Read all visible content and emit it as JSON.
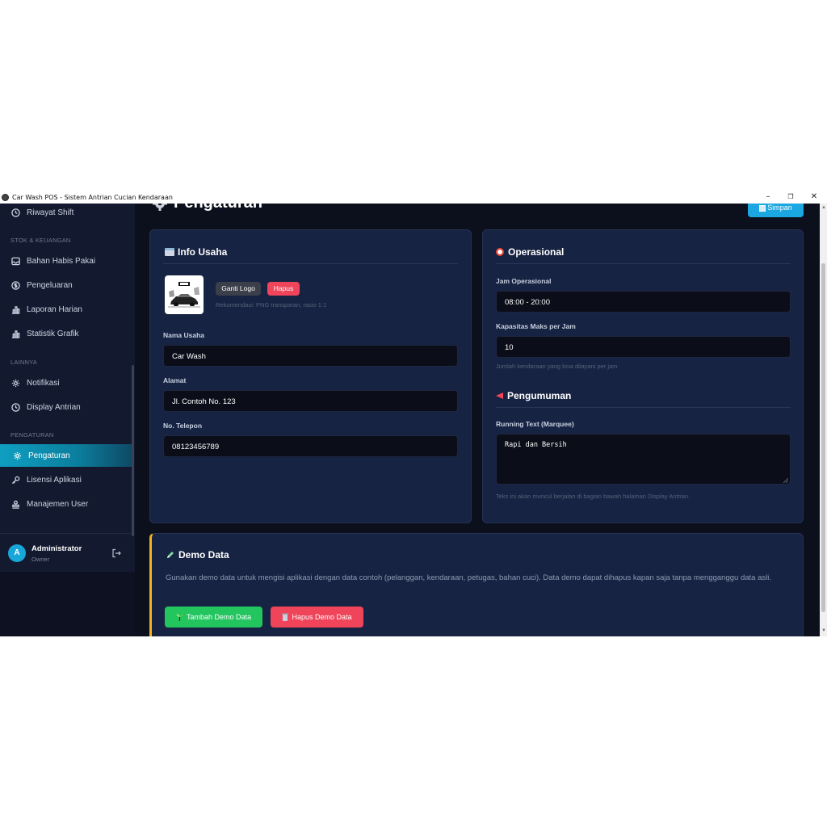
{
  "window": {
    "title": "Car Wash POS - Sistem Antrian Cucian Kendaraan",
    "controls": {
      "minimize": "–",
      "maximize": "❐",
      "close": "✕"
    }
  },
  "sidebar": {
    "items": [
      {
        "label": "Riwayat Shift",
        "icon": "clock-icon"
      },
      {
        "label": "Bahan Habis Pakai",
        "icon": "inbox-icon"
      },
      {
        "label": "Pengeluaran",
        "icon": "dollar-icon"
      },
      {
        "label": "Laporan Harian",
        "icon": "chart-icon"
      },
      {
        "label": "Statistik Grafik",
        "icon": "chart-icon"
      },
      {
        "label": "Notifikasi",
        "icon": "gear-icon"
      },
      {
        "label": "Display Antrian",
        "icon": "clock-icon"
      },
      {
        "label": "Pengaturan",
        "icon": "gear-icon"
      },
      {
        "label": "Lisensi Aplikasi",
        "icon": "key-icon"
      },
      {
        "label": "Manajemen User",
        "icon": "users-icon"
      }
    ],
    "sections": [
      "STOK & KEUANGAN",
      "LAINNYA",
      "PENGATURAN"
    ],
    "active": "Pengaturan",
    "accent": "#0f9fc2",
    "user": {
      "initial": "A",
      "name": "Administrator",
      "role": "Owner"
    }
  },
  "page": {
    "title": "Pengaturan",
    "save_label": "Simpan",
    "save_icon": "save-icon"
  },
  "info_usaha": {
    "title": "Info Usaha",
    "title_icon": "store-icon",
    "change_logo": "Ganti Logo",
    "delete_logo": "Hapus",
    "logo_hint": "Rekomendasi: PNG transparan, rasio 1:1",
    "business_name_label": "Nama Usaha",
    "business_name": "Car Wash",
    "address_label": "Alamat",
    "address": "Jl. Contoh No. 123",
    "phone_label": "No. Telepon",
    "phone": "08123456789"
  },
  "operasional": {
    "title": "Operasional",
    "title_icon": "alarm-clock-icon",
    "hours_label": "Jam Operasional",
    "hours": "08:00 - 20:00",
    "capacity_label": "Kapasitas Maks per Jam",
    "capacity": "10",
    "capacity_help": "Jumlah kendaraan yang bisa dilayani per jam"
  },
  "pengumuman": {
    "title": "Pengumuman",
    "title_icon": "megaphone-icon",
    "marquee_label": "Running Text (Marquee)",
    "marquee_value": "Rapi dan Bersih",
    "marquee_help": "Teks ini akan muncul berjalan di bagian bawah halaman Display Antrian."
  },
  "demo": {
    "title": "Demo Data",
    "title_icon": "pencil-icon",
    "description": "Gunakan demo data untuk mengisi aplikasi dengan data contoh (pelanggan, kendaraan, petugas, bahan cuci). Data demo dapat dihapus kapan saja tanpa mengganggu data asli.",
    "add_label": "Tambah Demo Data",
    "delete_label": "Hapus Demo Data",
    "add_color": "#22c55e",
    "delete_color": "#f0445a",
    "accent": "#f5b21a"
  }
}
